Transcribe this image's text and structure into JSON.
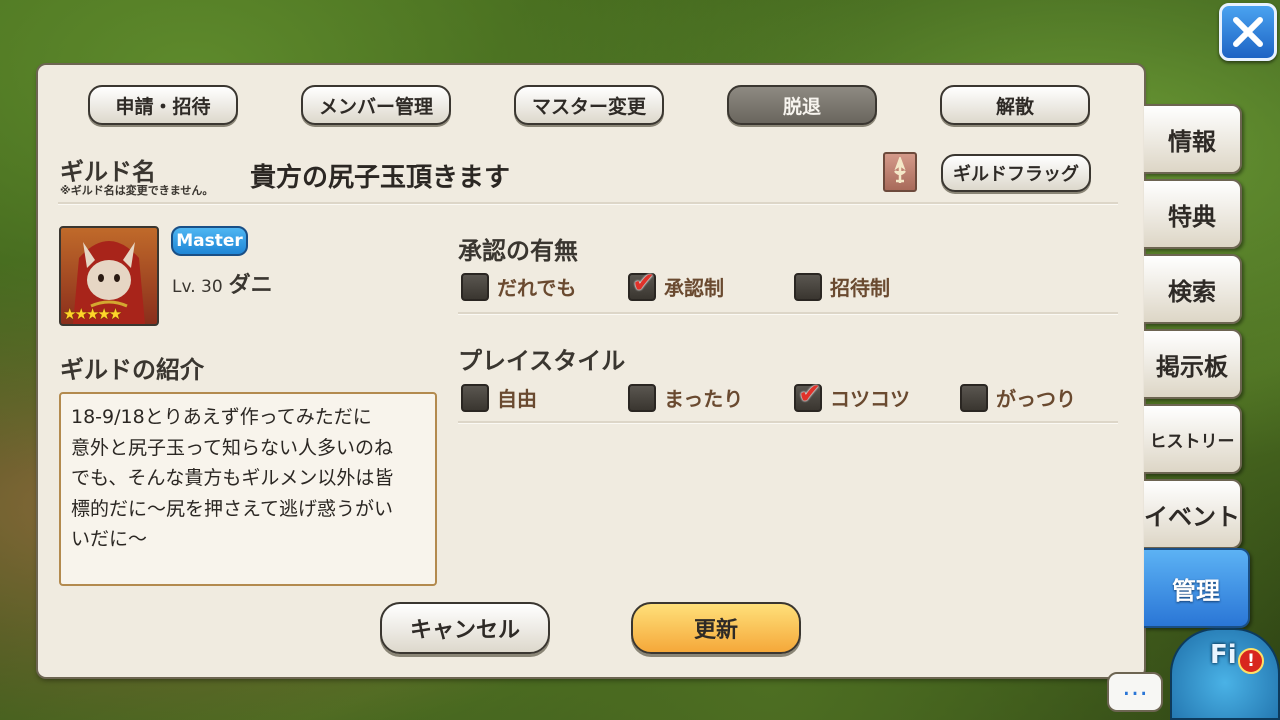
{
  "close_icon": "close-x-icon",
  "top_tabs": [
    "申請・招待",
    "メンバー管理",
    "マスター変更",
    "脱退",
    "解散"
  ],
  "active_top_tab": "脱退",
  "guild": {
    "name_label": "ギルド名",
    "name_note": "※ギルド名は変更できません。",
    "name": "貴方の尻子玉頂きます",
    "flag_button": "ギルドフラッグ"
  },
  "master": {
    "badge": "Master",
    "level": "Lv. 30",
    "name": "ダニ",
    "stars": "★★★★★"
  },
  "intro": {
    "title": "ギルドの紹介",
    "text": "18-9/18とりあえず作ってみただに\n意外と尻子玉って知らない人多いのね\nでも、そんな貴方もギルメン以外は皆\n標的だに〜尻を押さえて逃げ惑うがい\nいだに〜"
  },
  "approval": {
    "title": "承認の有無",
    "options": [
      {
        "label": "だれでも",
        "checked": false
      },
      {
        "label": "承認制",
        "checked": true
      },
      {
        "label": "招待制",
        "checked": false
      }
    ]
  },
  "playstyle": {
    "title": "プレイスタイル",
    "options": [
      {
        "label": "自由",
        "checked": false
      },
      {
        "label": "まったり",
        "checked": false
      },
      {
        "label": "コツコツ",
        "checked": true
      },
      {
        "label": "がっつり",
        "checked": false
      }
    ]
  },
  "buttons": {
    "cancel": "キャンセル",
    "update": "更新"
  },
  "side_tabs": [
    "情報",
    "特典",
    "検索",
    "掲示板",
    "ヒストリー",
    "イベント",
    "管理"
  ],
  "active_side_tab": "管理",
  "chat_label": "…",
  "mascot_label": "Fi",
  "alert_label": "!"
}
